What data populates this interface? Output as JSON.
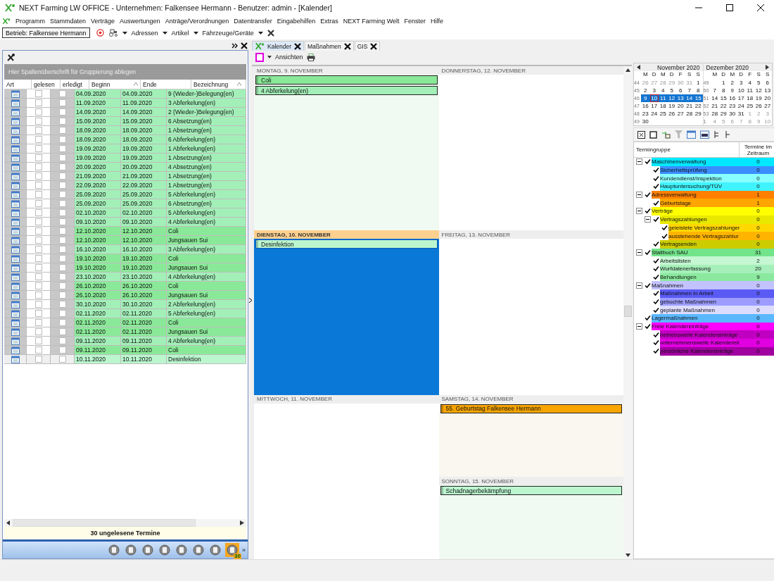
{
  "window": {
    "title": "NEXT Farming LW OFFICE - Unternehmen: Falkensee Hermann - Benutzer: admin - [Kalender]"
  },
  "menu": [
    "Programm",
    "Stammdaten",
    "Verträge",
    "Auswertungen",
    "Anträge/Verordnungen",
    "Datentransfer",
    "Eingabehilfen",
    "Extras",
    "NEXT Farming Welt",
    "Fenster",
    "Hilfe"
  ],
  "toolbar": {
    "betrieb": "Betrieb: Falkensee Hermann",
    "dropdowns": [
      "Adressen",
      "Artikel",
      "Fahrzeuge/Geräte"
    ]
  },
  "left_panel": {
    "group_hint": "Hier Spaltenüberschrift für Gruppierung ablegen",
    "columns": [
      "Art",
      "gelesen",
      "erledigt",
      "Beginn",
      "Ende",
      "Bezeichnung"
    ],
    "rows": [
      {
        "beginn": "04.09.2020",
        "ende": "04.09.2020",
        "bezeichnung": "9 (Wieder-)Belegung(en)",
        "color": "#a3efb8",
        "gelesen": false,
        "erledigt": false,
        "selected": false
      },
      {
        "beginn": "11.09.2020",
        "ende": "11.09.2020",
        "bezeichnung": "3 Abferkelung(en)",
        "color": "#a3efb8",
        "gelesen": false,
        "erledigt": false,
        "selected": false
      },
      {
        "beginn": "14.09.2020",
        "ende": "14.09.2020",
        "bezeichnung": "2 (Wieder-)Belegung(en)",
        "color": "#a3efb8",
        "gelesen": false,
        "erledigt": false,
        "selected": false
      },
      {
        "beginn": "15.09.2020",
        "ende": "15.09.2020",
        "bezeichnung": "6 Absetzung(en)",
        "color": "#a3efb8",
        "gelesen": false,
        "erledigt": false,
        "selected": false
      },
      {
        "beginn": "18.09.2020",
        "ende": "18.09.2020",
        "bezeichnung": "1 Absetzung(en)",
        "color": "#a3efb8",
        "gelesen": false,
        "erledigt": false,
        "selected": false
      },
      {
        "beginn": "18.09.2020",
        "ende": "18.09.2020",
        "bezeichnung": "6 Abferkelung(en)",
        "color": "#a3efb8",
        "gelesen": false,
        "erledigt": false,
        "selected": false
      },
      {
        "beginn": "19.09.2020",
        "ende": "19.09.2020",
        "bezeichnung": "1 Abferkelung(en)",
        "color": "#a3efb8",
        "gelesen": false,
        "erledigt": false,
        "selected": false
      },
      {
        "beginn": "19.09.2020",
        "ende": "19.09.2020",
        "bezeichnung": "1 Absetzung(en)",
        "color": "#a3efb8",
        "gelesen": false,
        "erledigt": false,
        "selected": false
      },
      {
        "beginn": "20.09.2020",
        "ende": "20.09.2020",
        "bezeichnung": "4 Absetzung(en)",
        "color": "#a3efb8",
        "gelesen": false,
        "erledigt": false,
        "selected": false
      },
      {
        "beginn": "21.09.2020",
        "ende": "21.09.2020",
        "bezeichnung": "1 Absetzung(en)",
        "color": "#a3efb8",
        "gelesen": false,
        "erledigt": false,
        "selected": false
      },
      {
        "beginn": "22.09.2020",
        "ende": "22.09.2020",
        "bezeichnung": "1 Absetzung(en)",
        "color": "#a3efb8",
        "gelesen": false,
        "erledigt": false,
        "selected": false
      },
      {
        "beginn": "25.09.2020",
        "ende": "25.09.2020",
        "bezeichnung": "5 Abferkelung(en)",
        "color": "#a3efb8",
        "gelesen": false,
        "erledigt": false,
        "selected": false
      },
      {
        "beginn": "25.09.2020",
        "ende": "25.09.2020",
        "bezeichnung": "6 Absetzung(en)",
        "color": "#a3efb8",
        "gelesen": false,
        "erledigt": false,
        "selected": false
      },
      {
        "beginn": "02.10.2020",
        "ende": "02.10.2020",
        "bezeichnung": "5 Abferkelung(en)",
        "color": "#a3efb8",
        "gelesen": false,
        "erledigt": false,
        "selected": false
      },
      {
        "beginn": "09.10.2020",
        "ende": "09.10.2020",
        "bezeichnung": "4 Abferkelung(en)",
        "color": "#a3efb8",
        "gelesen": false,
        "erledigt": false,
        "selected": false
      },
      {
        "beginn": "12.10.2020",
        "ende": "12.10.2020",
        "bezeichnung": "Coli",
        "color": "#8ae998",
        "gelesen": false,
        "erledigt": false,
        "selected": false
      },
      {
        "beginn": "12.10.2020",
        "ende": "12.10.2020",
        "bezeichnung": "Jungsauen Sui",
        "color": "#8ae998",
        "gelesen": false,
        "erledigt": false,
        "selected": false
      },
      {
        "beginn": "16.10.2020",
        "ende": "16.10.2020",
        "bezeichnung": "3 Abferkelung(en)",
        "color": "#a3efb8",
        "gelesen": false,
        "erledigt": false,
        "selected": false
      },
      {
        "beginn": "19.10.2020",
        "ende": "19.10.2020",
        "bezeichnung": "Coli",
        "color": "#8ae998",
        "gelesen": false,
        "erledigt": false,
        "selected": false
      },
      {
        "beginn": "19.10.2020",
        "ende": "19.10.2020",
        "bezeichnung": "Jungsauen Sui",
        "color": "#8ae998",
        "gelesen": false,
        "erledigt": false,
        "selected": false
      },
      {
        "beginn": "23.10.2020",
        "ende": "23.10.2020",
        "bezeichnung": "4 Abferkelung(en)",
        "color": "#a3efb8",
        "gelesen": false,
        "erledigt": false,
        "selected": false
      },
      {
        "beginn": "26.10.2020",
        "ende": "26.10.2020",
        "bezeichnung": "Coli",
        "color": "#8ae998",
        "gelesen": false,
        "erledigt": false,
        "selected": false
      },
      {
        "beginn": "26.10.2020",
        "ende": "26.10.2020",
        "bezeichnung": "Jungsauen Sui",
        "color": "#8ae998",
        "gelesen": false,
        "erledigt": false,
        "selected": false
      },
      {
        "beginn": "30.10.2020",
        "ende": "30.10.2020",
        "bezeichnung": "2 Abferkelung(en)",
        "color": "#a3efb8",
        "gelesen": false,
        "erledigt": false,
        "selected": false
      },
      {
        "beginn": "02.11.2020",
        "ende": "02.11.2020",
        "bezeichnung": "5 Abferkelung(en)",
        "color": "#a3efb8",
        "gelesen": false,
        "erledigt": false,
        "selected": false
      },
      {
        "beginn": "02.11.2020",
        "ende": "02.11.2020",
        "bezeichnung": "Coli",
        "color": "#8ae998",
        "gelesen": false,
        "erledigt": false,
        "selected": false
      },
      {
        "beginn": "02.11.2020",
        "ende": "02.11.2020",
        "bezeichnung": "Jungsauen Sui",
        "color": "#8ae998",
        "gelesen": false,
        "erledigt": false,
        "selected": false
      },
      {
        "beginn": "09.11.2020",
        "ende": "09.11.2020",
        "bezeichnung": "4 Abferkelung(en)",
        "color": "#a3efb8",
        "gelesen": false,
        "erledigt": false,
        "selected": false
      },
      {
        "beginn": "09.11.2020",
        "ende": "09.11.2020",
        "bezeichnung": "Coli",
        "color": "#8ae998",
        "gelesen": false,
        "erledigt": false,
        "selected": false
      },
      {
        "beginn": "10.11.2020",
        "ende": "10.11.2020",
        "bezeichnung": "Desinfektion",
        "color": "#bbf6cf",
        "gelesen": false,
        "erledigt": false,
        "selected": true
      }
    ],
    "footer": "30 ungelesene Termine",
    "bottom_toolbar": [
      {
        "selected": false
      },
      {
        "selected": false
      },
      {
        "selected": false
      },
      {
        "selected": false
      },
      {
        "selected": false
      },
      {
        "selected": false
      },
      {
        "selected": false
      },
      {
        "selected": true,
        "badge": "30"
      }
    ],
    "overflow": "»"
  },
  "tabs": [
    {
      "label": "Kalender",
      "kind": "app",
      "selected": true
    },
    {
      "label": "Maßnahmen",
      "kind": "page",
      "selected": false
    },
    {
      "label": "GIS",
      "kind": "page",
      "selected": false
    }
  ],
  "calendar_toolbar": {
    "views": "Ansichten"
  },
  "days": [
    {
      "label": "MONTAG, 9. NOVEMBER",
      "kind": "weekday",
      "today": false,
      "selected": false,
      "color": "#f1faf2",
      "events": [
        {
          "label": "Coli",
          "color": "#8ae998"
        },
        {
          "label": "4 Abferkelung(en)",
          "color": "#a3efb8"
        }
      ]
    },
    {
      "label": "DIENSTAG, 10. NOVEMBER",
      "kind": "weekday",
      "today": true,
      "selected": true,
      "events": [
        {
          "label": "Desinfektion",
          "color": "#bbf6cf"
        }
      ]
    },
    {
      "label": "MITTWOCH, 11. NOVEMBER",
      "kind": "weekday",
      "today": false,
      "selected": false,
      "color": "#ffffff"
    },
    {
      "label": "DONNERSTAG, 12. NOVEMBER",
      "kind": "weekday",
      "today": false,
      "selected": false,
      "color": "#ffffff"
    },
    {
      "label": "FREITAG, 13. NOVEMBER",
      "kind": "weekday",
      "today": false,
      "selected": false,
      "color": "#ffffff"
    },
    {
      "label": "SAMSTAG, 14. NOVEMBER",
      "kind": "weekend",
      "today": false,
      "selected": false,
      "color": "#faf7f0",
      "events": [
        {
          "label": "55. Geburtstag Falkensee Hermann",
          "color": "#f8a500"
        }
      ]
    },
    {
      "label": "SONNTAG, 15. NOVEMBER",
      "kind": "weekend",
      "today": false,
      "selected": false,
      "color": "#f1faf2",
      "events": [
        {
          "label": "Schadnagerbekämpfung",
          "color": "#bbf6cf"
        }
      ]
    }
  ],
  "mini_calendar": [
    {
      "title": "November 2020",
      "weekdays": [
        "M",
        "D",
        "M",
        "D",
        "F",
        "S",
        "S"
      ],
      "weeks": [
        {
          "nr": "44",
          "selected": false,
          "days": [
            {
              "d": "26",
              "muted": true,
              "today": false
            },
            {
              "d": "27",
              "muted": true,
              "today": false
            },
            {
              "d": "28",
              "muted": true,
              "today": false
            },
            {
              "d": "29",
              "muted": true,
              "today": false
            },
            {
              "d": "30",
              "muted": true,
              "today": false
            },
            {
              "d": "31",
              "muted": true,
              "today": false
            },
            {
              "d": "1",
              "muted": false,
              "today": false
            }
          ]
        },
        {
          "nr": "45",
          "selected": false,
          "days": [
            {
              "d": "2",
              "muted": false,
              "today": false
            },
            {
              "d": "3",
              "muted": false,
              "today": false
            },
            {
              "d": "4",
              "muted": false,
              "today": false
            },
            {
              "d": "5",
              "muted": false,
              "today": false
            },
            {
              "d": "6",
              "muted": false,
              "today": false
            },
            {
              "d": "7",
              "muted": false,
              "today": false
            },
            {
              "d": "8",
              "muted": false,
              "today": false
            }
          ]
        },
        {
          "nr": "46",
          "selected": true,
          "days": [
            {
              "d": "9",
              "muted": false,
              "today": false
            },
            {
              "d": "10",
              "muted": false,
              "today": true
            },
            {
              "d": "11",
              "muted": false,
              "today": false
            },
            {
              "d": "12",
              "muted": false,
              "today": false
            },
            {
              "d": "13",
              "muted": false,
              "today": false
            },
            {
              "d": "14",
              "muted": false,
              "today": false
            },
            {
              "d": "15",
              "muted": false,
              "today": false
            }
          ]
        },
        {
          "nr": "47",
          "selected": false,
          "days": [
            {
              "d": "16",
              "muted": false,
              "today": false
            },
            {
              "d": "17",
              "muted": false,
              "today": false
            },
            {
              "d": "18",
              "muted": false,
              "today": false
            },
            {
              "d": "19",
              "muted": false,
              "today": false
            },
            {
              "d": "20",
              "muted": false,
              "today": false
            },
            {
              "d": "21",
              "muted": false,
              "today": false
            },
            {
              "d": "22",
              "muted": false,
              "today": false
            }
          ]
        },
        {
          "nr": "48",
          "selected": false,
          "days": [
            {
              "d": "23",
              "muted": false,
              "today": false
            },
            {
              "d": "24",
              "muted": false,
              "today": false
            },
            {
              "d": "25",
              "muted": false,
              "today": false
            },
            {
              "d": "26",
              "muted": false,
              "today": false
            },
            {
              "d": "27",
              "muted": false,
              "today": false
            },
            {
              "d": "28",
              "muted": false,
              "today": false
            },
            {
              "d": "29",
              "muted": false,
              "today": false
            }
          ]
        },
        {
          "nr": "49",
          "selected": false,
          "days": [
            {
              "d": "30",
              "muted": false,
              "today": false
            }
          ]
        }
      ]
    },
    {
      "title": "Dezember 2020",
      "weekdays": [
        "M",
        "D",
        "M",
        "D",
        "F",
        "S",
        "S"
      ],
      "weeks": [
        {
          "nr": "49",
          "selected": false,
          "days": [
            {
              "d": "1",
              "muted": false,
              "today": false
            },
            {
              "d": "2",
              "muted": false,
              "today": false
            },
            {
              "d": "3",
              "muted": false,
              "today": false
            },
            {
              "d": "4",
              "muted": false,
              "today": false
            },
            {
              "d": "5",
              "muted": false,
              "today": false
            },
            {
              "d": "6",
              "muted": false,
              "today": false
            }
          ]
        },
        {
          "nr": "50",
          "selected": false,
          "days": [
            {
              "d": "7",
              "muted": false,
              "today": false
            },
            {
              "d": "8",
              "muted": false,
              "today": false
            },
            {
              "d": "9",
              "muted": false,
              "today": false
            },
            {
              "d": "10",
              "muted": false,
              "today": false
            },
            {
              "d": "11",
              "muted": false,
              "today": false
            },
            {
              "d": "12",
              "muted": false,
              "today": false
            },
            {
              "d": "13",
              "muted": false,
              "today": false
            }
          ]
        },
        {
          "nr": "51",
          "selected": false,
          "days": [
            {
              "d": "14",
              "muted": false,
              "today": false
            },
            {
              "d": "15",
              "muted": false,
              "today": false
            },
            {
              "d": "16",
              "muted": false,
              "today": false
            },
            {
              "d": "17",
              "muted": false,
              "today": false
            },
            {
              "d": "18",
              "muted": false,
              "today": false
            },
            {
              "d": "19",
              "muted": false,
              "today": false
            },
            {
              "d": "20",
              "muted": false,
              "today": false
            }
          ]
        },
        {
          "nr": "52",
          "selected": false,
          "days": [
            {
              "d": "21",
              "muted": false,
              "today": false
            },
            {
              "d": "22",
              "muted": false,
              "today": false
            },
            {
              "d": "23",
              "muted": false,
              "today": false
            },
            {
              "d": "24",
              "muted": false,
              "today": false
            },
            {
              "d": "25",
              "muted": false,
              "today": false
            },
            {
              "d": "26",
              "muted": false,
              "today": false
            },
            {
              "d": "27",
              "muted": false,
              "today": false
            }
          ]
        },
        {
          "nr": "53",
          "selected": false,
          "days": [
            {
              "d": "28",
              "muted": false,
              "today": false
            },
            {
              "d": "29",
              "muted": false,
              "today": false
            },
            {
              "d": "30",
              "muted": false,
              "today": false
            },
            {
              "d": "31",
              "muted": false,
              "today": false
            },
            {
              "d": "1",
              "muted": true,
              "today": false
            },
            {
              "d": "2",
              "muted": true,
              "today": false
            },
            {
              "d": "3",
              "muted": true,
              "today": false
            }
          ]
        },
        {
          "nr": "1",
          "selected": false,
          "days": [
            {
              "d": "4",
              "muted": true,
              "today": false
            },
            {
              "d": "5",
              "muted": true,
              "today": false
            },
            {
              "d": "6",
              "muted": true,
              "today": false
            },
            {
              "d": "7",
              "muted": true,
              "today": false
            },
            {
              "d": "8",
              "muted": true,
              "today": false
            },
            {
              "d": "9",
              "muted": true,
              "today": false
            },
            {
              "d": "10",
              "muted": true,
              "today": false
            }
          ]
        }
      ]
    }
  ],
  "groups": {
    "columns": [
      "Termingruppe",
      "Termine im Zeitraum"
    ],
    "items": [
      {
        "label": "Maschinenverwaltung",
        "count": "0",
        "checked": true,
        "color": "#00e8ff",
        "expanded": true,
        "children": [
          {
            "label": "Sicherheitsprüfung",
            "count": "0",
            "checked": true,
            "color": "#3b8eff"
          },
          {
            "label": "Kundendienst/Inspektion",
            "count": "0",
            "checked": true,
            "color": "#88ffff"
          },
          {
            "label": "Hauptuntersuchung/TÜV",
            "count": "0",
            "checked": true,
            "color": "#40f4ff"
          }
        ]
      },
      {
        "label": "Adressverwaltung",
        "count": "1",
        "checked": true,
        "color": "#ff8000",
        "expanded": true,
        "children": [
          {
            "label": "Geburtstage",
            "count": "1",
            "checked": true,
            "color": "#ffa500"
          }
        ]
      },
      {
        "label": "Verträge",
        "count": "0",
        "checked": true,
        "color": "#ffff00",
        "expanded": true,
        "children": [
          {
            "label": "Vertragszahlungen",
            "count": "0",
            "checked": true,
            "color": "#e8e800",
            "expanded": true,
            "children": [
              {
                "label": "geleistete Vertragszahlunger",
                "count": "0",
                "checked": true,
                "color": "#ffd800"
              },
              {
                "label": "ausstehende Vertragszahlur",
                "count": "0",
                "checked": true,
                "color": "#ffb400"
              }
            ]
          },
          {
            "label": "Vertragsenden",
            "count": "0",
            "checked": true,
            "color": "#cccc00"
          }
        ]
      },
      {
        "label": "Stallbuch SAU",
        "count": "31",
        "checked": true,
        "color": "#72e48a",
        "expanded": true,
        "children": [
          {
            "label": "Arbeitslisten",
            "count": "2",
            "checked": true,
            "color": "#c4f7d2"
          },
          {
            "label": "Wurfdatenerfassung",
            "count": "20",
            "checked": true,
            "color": "#a6efba"
          },
          {
            "label": "Behandlungen",
            "count": "9",
            "checked": true,
            "color": "#8ae99e"
          }
        ]
      },
      {
        "label": "Maßnahmen",
        "count": "0",
        "checked": true,
        "color": "#c2c2ff",
        "expanded": true,
        "children": [
          {
            "label": "Maßnahmen in Arbeit",
            "count": "0",
            "checked": true,
            "color": "#5a5af5"
          },
          {
            "label": "gebuchte Maßnahmen",
            "count": "0",
            "checked": true,
            "color": "#9c9cff"
          },
          {
            "label": "geplante Maßnahmen",
            "count": "0",
            "checked": true,
            "color": "#dcdcff"
          }
        ]
      },
      {
        "label": "Lagermaßnahmen",
        "count": "0",
        "checked": true,
        "color": "#5ab8ff"
      },
      {
        "label": "Freie Kalendereinträge",
        "count": "0",
        "checked": true,
        "color": "#ff00ff",
        "expanded": true,
        "children": [
          {
            "label": "betriebsweite Kalendereinträge",
            "count": "0",
            "checked": true,
            "color": "#c000c0"
          },
          {
            "label": "unternehmensweite Kalendereir",
            "count": "0",
            "checked": true,
            "color": "#e000e0"
          },
          {
            "label": "persönliche Kalendereinträge",
            "count": "0",
            "checked": true,
            "color": "#a000a0"
          }
        ]
      }
    ]
  }
}
